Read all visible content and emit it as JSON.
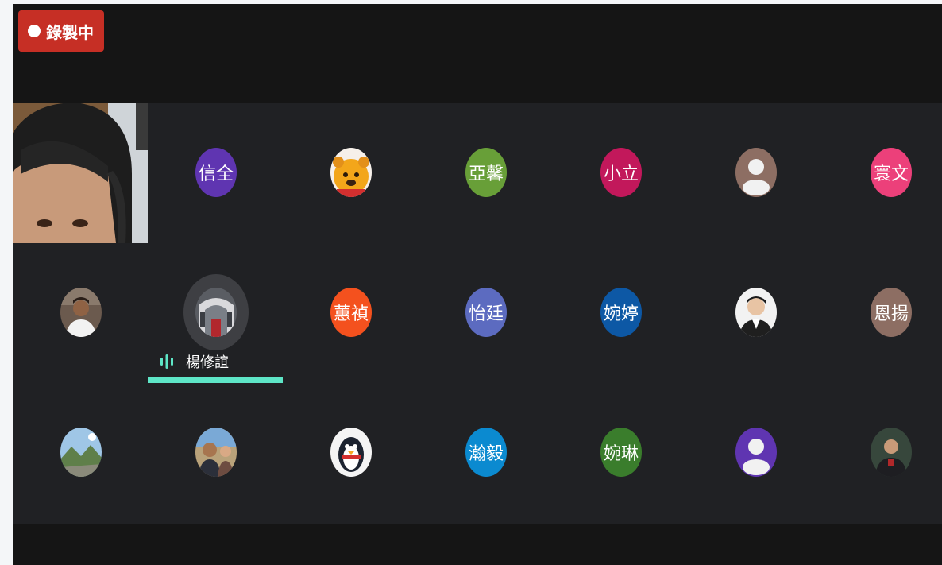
{
  "recording": {
    "label": "錄製中",
    "color": "#c62f25"
  },
  "active_speaker": {
    "name": "楊修誼",
    "indicator_color": "#5ee6c7",
    "icon": "audio-level-icon"
  },
  "participants": [
    {
      "initials": "信全",
      "color": "#5f35b1"
    },
    {
      "icon": "winnie-the-pooh-avatar-icon"
    },
    {
      "initials": "亞馨",
      "color": "#689f38"
    },
    {
      "initials": "小立",
      "color": "#c2185b"
    },
    {
      "icon": "default-person-icon",
      "color": "#8d6e63"
    },
    {
      "initials": "寰文",
      "color": "#ec407a"
    },
    {
      "icon": "man-photo-avatar-icon"
    },
    {
      "icon": "room-photo-avatar-icon"
    },
    {
      "initials": "蕙禎",
      "color": "#f4511e"
    },
    {
      "initials": "怡廷",
      "color": "#5c6bc0"
    },
    {
      "initials": "婉婷",
      "color": "#0d58a5"
    },
    {
      "icon": "graduate-photo-avatar-icon"
    },
    {
      "initials": "恩揚",
      "color": "#8d6e63"
    },
    {
      "icon": "landscape-photo-avatar-icon"
    },
    {
      "icon": "couple-photo-avatar-icon"
    },
    {
      "icon": "penguin-avatar-icon"
    },
    {
      "initials": "瀚毅",
      "color": "#0b8ad0"
    },
    {
      "initials": "婉琳",
      "color": "#3a7d2c"
    },
    {
      "icon": "default-person-icon",
      "color": "#5f35b1"
    },
    {
      "icon": "speaker-photo-avatar-icon"
    }
  ]
}
